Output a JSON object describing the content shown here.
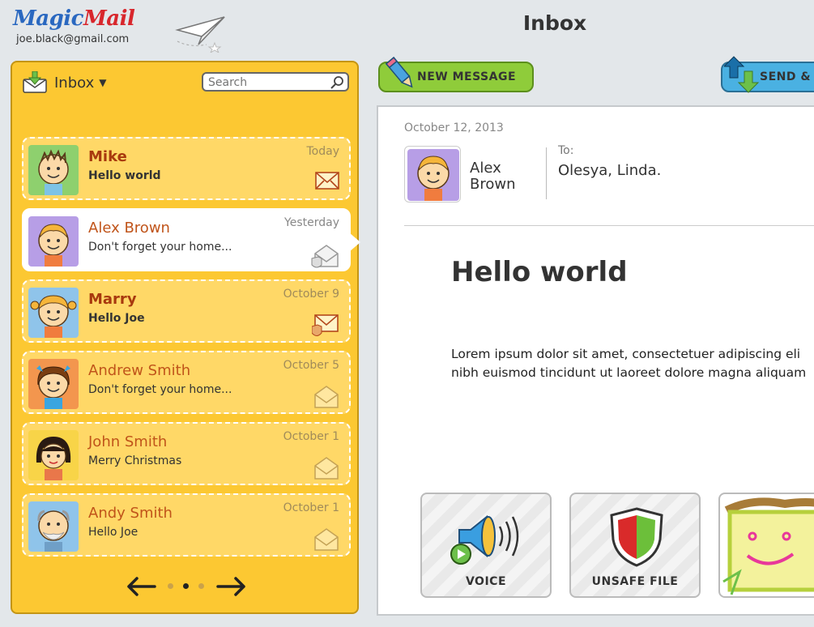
{
  "header": {
    "logo_left": "Magic",
    "logo_right": "Mail",
    "account_email": "joe.black@gmail.com",
    "title": "Inbox"
  },
  "sidebar": {
    "folder_label": "Inbox",
    "search_placeholder": "Search",
    "messages": [
      {
        "sender": "Mike",
        "preview": "Hello world",
        "date": "Today",
        "unread": true
      },
      {
        "sender": "Alex Brown",
        "preview": "Don't forget your home...",
        "date": "Yesterday",
        "unread": false,
        "selected": true
      },
      {
        "sender": "Marry",
        "preview": "Hello Joe",
        "date": "October 9",
        "unread": true
      },
      {
        "sender": "Andrew Smith",
        "preview": "Don't forget your home...",
        "date": "October 5",
        "unread": false
      },
      {
        "sender": "John Smith",
        "preview": "Merry Christmas",
        "date": "October 1",
        "unread": false
      },
      {
        "sender": "Andy Smith",
        "preview": "Hello Joe",
        "date": "October 1",
        "unread": false
      }
    ]
  },
  "toolbar": {
    "new_message_label": "NEW MESSAGE",
    "send_label": "SEND &"
  },
  "message": {
    "date": "October 12, 2013",
    "from_first": "Alex",
    "from_last": "Brown",
    "to_label": "To:",
    "to_value": "Olesya, Linda.",
    "subject": "Hello world",
    "body_line1": "Lorem ipsum dolor sit amet, consectetuer adipiscing eli",
    "body_line2": "nibh euismod tincidunt ut laoreet dolore magna aliquam"
  },
  "attachments": [
    {
      "label": "VOICE",
      "icon": "speaker-icon"
    },
    {
      "label": "UNSAFE FILE",
      "icon": "shield-icon"
    },
    {
      "label": "",
      "icon": "drawing-thumbnail"
    }
  ],
  "colors": {
    "sidebar_bg": "#fcc832",
    "new_button": "#8fcc3a",
    "send_button": "#4ab1e2",
    "sender_name": "#a8390e"
  }
}
